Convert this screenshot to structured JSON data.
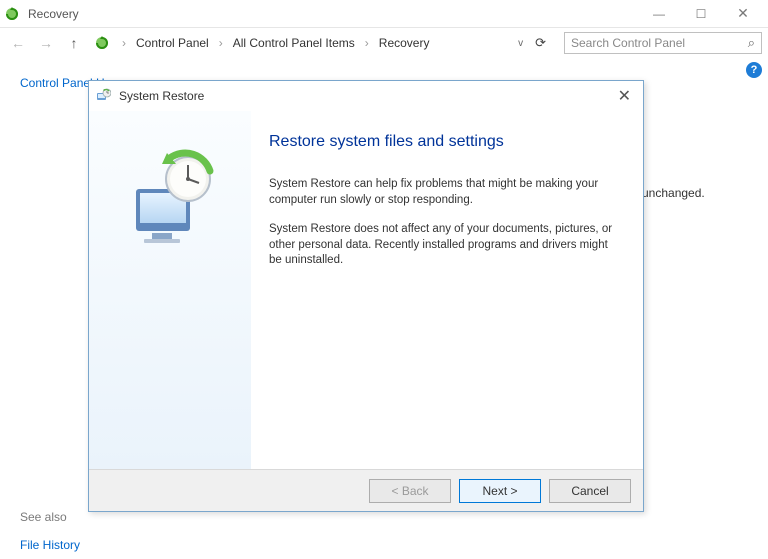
{
  "window": {
    "title": "Recovery",
    "minimize": "—",
    "maximize": "☐",
    "close": "✕"
  },
  "nav": {
    "back_icon": "←",
    "forward_icon": "→",
    "up_icon": "↑",
    "crumbs": {
      "sep": "›",
      "c1": "Control Panel",
      "c2": "All Control Panel Items",
      "c3": "Recovery"
    },
    "dropdown_chev": "v",
    "refresh": "⟳",
    "search_placeholder": "Search Control Panel",
    "search_icon": "⌕"
  },
  "help": {
    "label": "?"
  },
  "sidebar": {
    "home": "Control Panel Home",
    "seealso_label": "See also",
    "file_history": "File History"
  },
  "bg_fragment": "ic unchanged.",
  "dialog": {
    "title": "System Restore",
    "close": "✕",
    "heading": "Restore system files and settings",
    "para1": "System Restore can help fix problems that might be making your computer run slowly or stop responding.",
    "para2": "System Restore does not affect any of your documents, pictures, or other personal data. Recently installed programs and drivers might be uninstalled.",
    "buttons": {
      "back": "< Back",
      "next": "Next >",
      "cancel": "Cancel"
    }
  }
}
